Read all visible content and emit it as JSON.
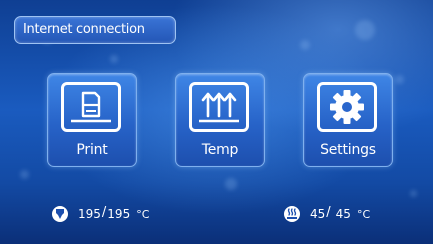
{
  "header": {
    "internet_button_label": "Internet connection"
  },
  "tiles": [
    {
      "label": "Print",
      "icon": "print-icon"
    },
    {
      "label": "Temp",
      "icon": "heat-arrows-icon"
    },
    {
      "label": "Settings",
      "icon": "gear-icon"
    }
  ],
  "status": {
    "nozzle": {
      "icon": "nozzle-icon",
      "current": "195",
      "target": "195",
      "unit": "°C"
    },
    "bed": {
      "icon": "heated-bed-icon",
      "current": "45",
      "target": "45",
      "unit": "°C"
    }
  },
  "colors": {
    "background": "#1a5bbf",
    "tile": "#2f72d8",
    "tile_border": "#7fb0ee",
    "text": "#ffffff"
  }
}
